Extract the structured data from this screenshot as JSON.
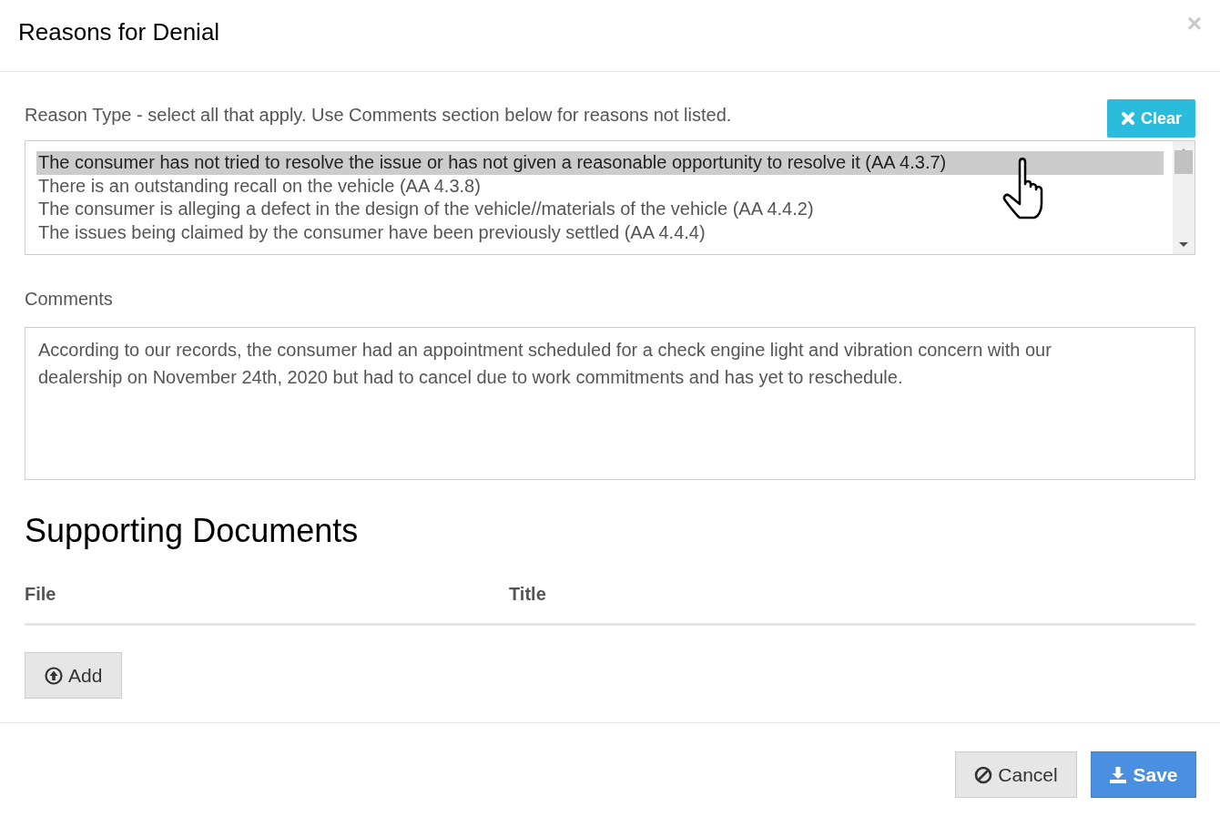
{
  "dialog": {
    "title": "Reasons for Denial",
    "close": "×"
  },
  "reason_type": {
    "label": "Reason Type - select all that apply. Use Comments section below for reasons not listed.",
    "clear_button": "Clear",
    "options": [
      {
        "label": "The consumer has not tried to resolve the issue or has not given a reasonable opportunity to resolve it (AA 4.3.7)",
        "selected": true
      },
      {
        "label": "There is an outstanding recall on the vehicle (AA 4.3.8)",
        "selected": false
      },
      {
        "label": "The consumer is alleging a defect in the design of the vehicle//materials of the vehicle (AA 4.4.2)",
        "selected": false
      },
      {
        "label": "The issues being claimed by the consumer have been previously settled (AA 4.4.4)",
        "selected": false
      }
    ]
  },
  "comments": {
    "label": "Comments",
    "value": "According to our records, the consumer had an appointment scheduled for a check engine light and vibration concern with our dealership on November 24th, 2020 but had to cancel due to work commitments and has yet to reschedule."
  },
  "supporting_documents": {
    "heading": "Supporting Documents",
    "columns": [
      "File",
      "Title"
    ],
    "add_button": "Add"
  },
  "footer": {
    "buttons": [
      {
        "label": "Cancel",
        "kind": "cancel"
      },
      {
        "label": "Save",
        "kind": "save"
      }
    ]
  }
}
